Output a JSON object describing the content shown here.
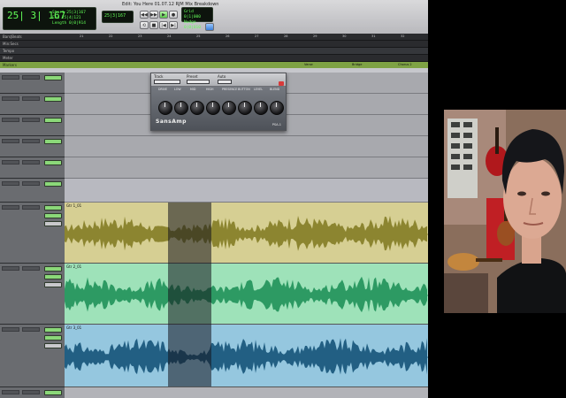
{
  "window": {
    "title": "Edit: You Here 01.07.12 RJM Mix Breakdown"
  },
  "transport": {
    "main_counter": "25| 3| 167",
    "counter_details": [
      "Start 25|3|167",
      "End 25|4|121",
      "Length 0|0|914"
    ],
    "sub_counter": "25|3|167",
    "right_counter": [
      "Grid 0|1|000",
      "Nudge 0|0|010"
    ],
    "buttons": [
      "rewind",
      "fast-forward",
      "stop",
      "play",
      "record",
      "loop"
    ]
  },
  "rulers": {
    "labels": [
      "Bars|Beats",
      "Min:Secs",
      "Tempo",
      "Meter",
      "Markers"
    ],
    "bar_ticks": [
      "21",
      "22",
      "23",
      "24",
      "25",
      "26",
      "27",
      "28",
      "29",
      "30",
      "31",
      "32"
    ],
    "markers": [
      "Verse",
      "Bridge",
      "Chorus 2"
    ]
  },
  "plugin": {
    "header": {
      "track": "Track",
      "preset": "Preset",
      "auto": "Auto"
    },
    "knobs": [
      "DRIVE",
      "LOW",
      "MID",
      "HIGH",
      "PRESENCE",
      "BUTTON",
      "LEVEL",
      "BLEND"
    ],
    "logo": "SansAmp",
    "brand": "PSA-1"
  },
  "clips": [
    {
      "name": "Gtr 1_01",
      "color": "#d6cf93",
      "wave": "#8c8530"
    },
    {
      "name": "Gtr 2_01",
      "color": "#9ee2b9",
      "wave": "#2d9a63"
    },
    {
      "name": "Gtr 3_01",
      "color": "#95c7df",
      "wave": "#225f83"
    }
  ]
}
